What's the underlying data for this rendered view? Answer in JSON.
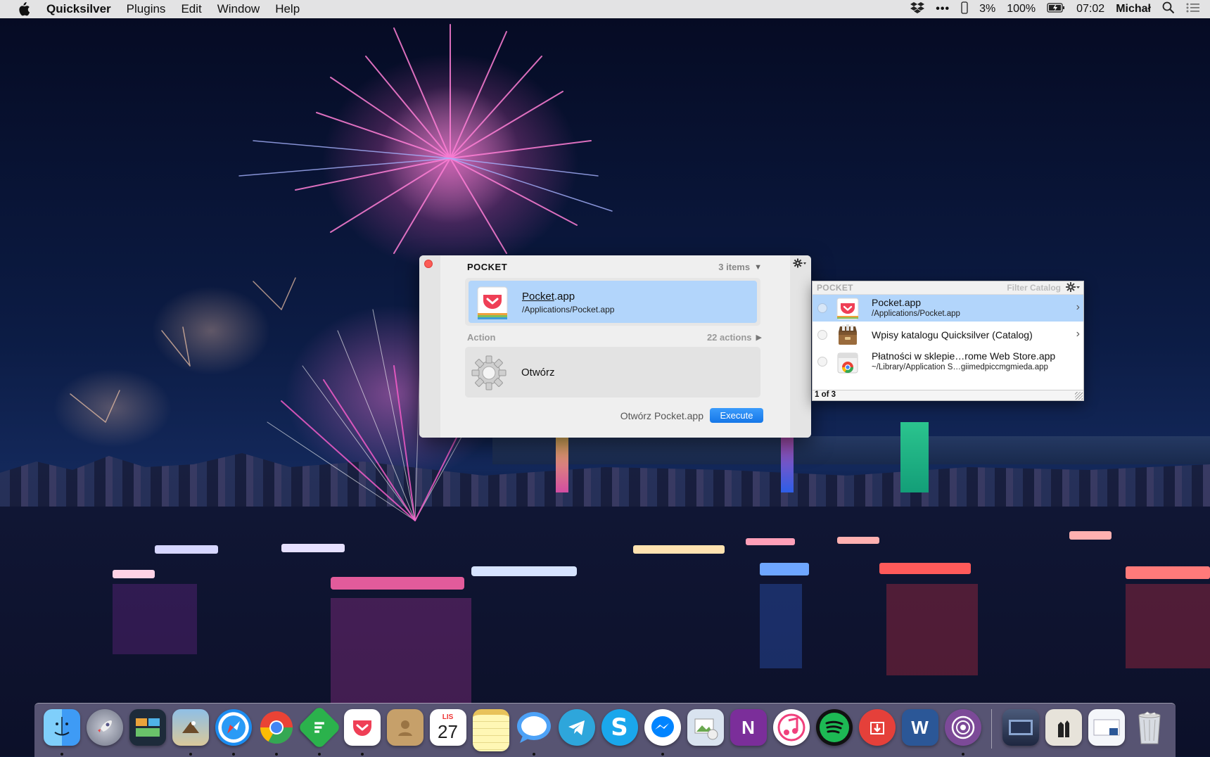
{
  "menubar": {
    "app_name": "Quicksilver",
    "menus": [
      "Plugins",
      "Edit",
      "Window",
      "Help"
    ],
    "battery_small": "3%",
    "battery": "100%",
    "clock": "07:02",
    "user": "Michał"
  },
  "qs_main": {
    "title": "POCKET",
    "items_count": "3 items",
    "object_name_underlined": "Pocket",
    "object_name_rest": ".app",
    "object_path": "/Applications/Pocket.app",
    "action_label": "Action",
    "actions_count": "22 actions",
    "action_name": "Otwórz",
    "footer_text": "Otwórz Pocket.app",
    "execute_label": "Execute"
  },
  "qs_list": {
    "title": "POCKET",
    "filter_label": "Filter Catalog",
    "rows": [
      {
        "name": "Pocket.app",
        "sub": "/Applications/Pocket.app",
        "icon": "pocket-icon",
        "selected": true
      },
      {
        "name": "Wpisy katalogu Quicksilver (Catalog)",
        "sub": "",
        "icon": "catalog-box-icon",
        "selected": false
      },
      {
        "name": "Płatności w sklepie…rome Web Store.app",
        "sub": "~/Library/Application S…giimedpiccmgmieda.app",
        "icon": "chrome-app-icon",
        "selected": false
      }
    ],
    "footer": "1 of 3"
  },
  "dock": {
    "calendar_month": "LIS",
    "calendar_day": "27",
    "apps": [
      {
        "name": "finder",
        "color": "#3e9bf5",
        "running": true
      },
      {
        "name": "launchpad",
        "color": "#8a8fa0",
        "running": false
      },
      {
        "name": "mission-control",
        "color": "#1d2b3a",
        "running": false
      },
      {
        "name": "mail-preview",
        "color": "#cbb489",
        "running": true
      },
      {
        "name": "safari",
        "color": "#1b8cf0",
        "running": true
      },
      {
        "name": "chrome",
        "color": "#ffffff",
        "running": true
      },
      {
        "name": "feedly",
        "color": "#2bb24c",
        "running": true
      },
      {
        "name": "pocket",
        "color": "#ffffff",
        "running": true
      },
      {
        "name": "contacts",
        "color": "#c6a06a",
        "running": false
      },
      {
        "name": "calendar",
        "color": "#ffffff",
        "running": false
      },
      {
        "name": "notes",
        "color": "#fff7b5",
        "running": false
      },
      {
        "name": "messages",
        "color": "#4da2f7",
        "running": true
      },
      {
        "name": "telegram",
        "color": "#2ea6db",
        "running": false
      },
      {
        "name": "skype",
        "color": "#1aa7ec",
        "running": false
      },
      {
        "name": "messenger",
        "color": "#ffffff",
        "running": true
      },
      {
        "name": "preview",
        "color": "#d9e3ef",
        "running": false
      },
      {
        "name": "onenote",
        "color": "#7b2e9a",
        "running": false
      },
      {
        "name": "itunes",
        "color": "#ffffff",
        "running": false
      },
      {
        "name": "spotify",
        "color": "#1db954",
        "running": false
      },
      {
        "name": "transmit",
        "color": "#e5403a",
        "running": false
      },
      {
        "name": "word",
        "color": "#2b5797",
        "running": false
      },
      {
        "name": "tor-browser",
        "color": "#7c4a98",
        "running": true
      }
    ],
    "stacks": [
      {
        "name": "downloads-stack"
      },
      {
        "name": "documents-stack"
      },
      {
        "name": "word-doc-stack"
      },
      {
        "name": "trash"
      }
    ]
  }
}
